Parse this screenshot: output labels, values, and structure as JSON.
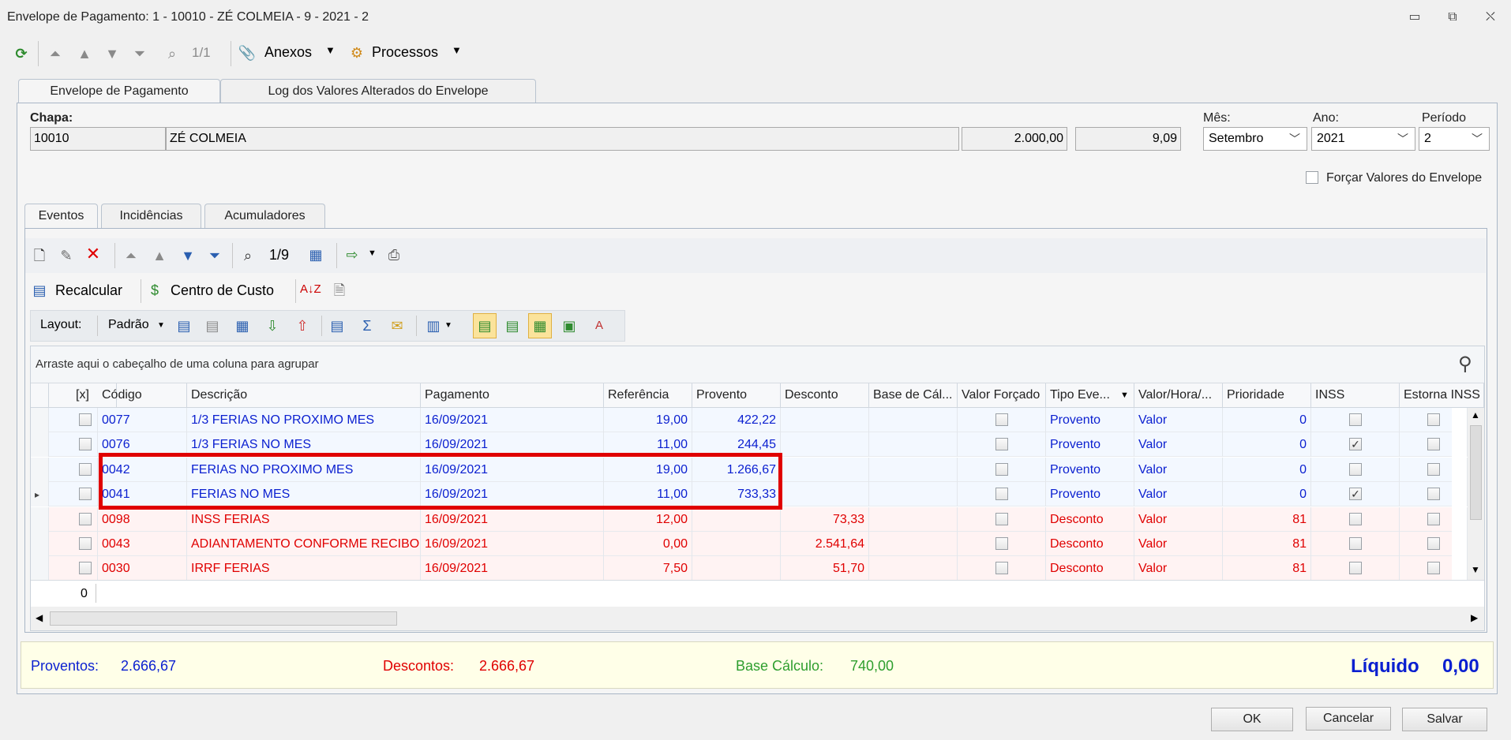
{
  "window": {
    "title": "Envelope de Pagamento: 1 - 10010 - ZÉ COLMEIA - 9 - 2021 - 2",
    "minimize": "▭",
    "restore": "⧉",
    "close": "⛌"
  },
  "toolbar": {
    "counter": "1/1",
    "anexos_label": "Anexos",
    "processos_label": "Processos"
  },
  "main_tabs": [
    "Envelope de Pagamento",
    "Log dos Valores Alterados do Envelope"
  ],
  "header": {
    "chapa_label": "Chapa:",
    "chapa_value": "10010",
    "name_value": "ZÉ COLMEIA",
    "salary_value": "2.000,00",
    "hourly_value": "9,09",
    "mes_label": "Mês:",
    "mes_value": "Setembro",
    "ano_label": "Ano:",
    "ano_value": "2021",
    "periodo_label": "Período",
    "periodo_value": "2",
    "forcar_label": "Forçar Valores do Envelope",
    "forcar_checked": false
  },
  "sub_tabs": [
    "Eventos",
    "Incidências",
    "Acumuladores"
  ],
  "events_toolbar": {
    "counter": "1/9",
    "recalcular_label": "Recalcular",
    "centro_label": "Centro de Custo",
    "layout_label": "Layout:",
    "padrao_label": "Padrão"
  },
  "grid": {
    "group_hint": "Arraste aqui o cabeçalho de uma coluna para agrupar",
    "columns": [
      "[x]",
      "Código",
      "Descrição",
      "Pagamento",
      "Referência",
      "Provento",
      "Desconto",
      "Base de Cál...",
      "Valor Forçado",
      "Tipo Eve...",
      "Valor/Hora/...",
      "Prioridade",
      "INSS",
      "Estorna INSS"
    ],
    "rows": [
      {
        "codigo": "0077",
        "descricao": "1/3 FERIAS NO PROXIMO MES",
        "pagamento": "16/09/2021",
        "referencia": "19,00",
        "provento": "422,22",
        "desconto": "",
        "tipo": "Provento",
        "valor": "Valor",
        "prioridade": "0",
        "inss": false,
        "kind": "provento"
      },
      {
        "codigo": "0076",
        "descricao": "1/3 FERIAS NO MES",
        "pagamento": "16/09/2021",
        "referencia": "11,00",
        "provento": "244,45",
        "desconto": "",
        "tipo": "Provento",
        "valor": "Valor",
        "prioridade": "0",
        "inss": true,
        "kind": "provento"
      },
      {
        "codigo": "0042",
        "descricao": "FERIAS NO PROXIMO MES",
        "pagamento": "16/09/2021",
        "referencia": "19,00",
        "provento": "1.266,67",
        "desconto": "",
        "tipo": "Provento",
        "valor": "Valor",
        "prioridade": "0",
        "inss": false,
        "kind": "provento"
      },
      {
        "codigo": "0041",
        "descricao": "FERIAS NO MES",
        "pagamento": "16/09/2021",
        "referencia": "11,00",
        "provento": "733,33",
        "desconto": "",
        "tipo": "Provento",
        "valor": "Valor",
        "prioridade": "0",
        "inss": true,
        "kind": "provento"
      },
      {
        "codigo": "0098",
        "descricao": "INSS FERIAS",
        "pagamento": "16/09/2021",
        "referencia": "12,00",
        "provento": "",
        "desconto": "73,33",
        "tipo": "Desconto",
        "valor": "Valor",
        "prioridade": "81",
        "inss": false,
        "kind": "desconto"
      },
      {
        "codigo": "0043",
        "descricao": "ADIANTAMENTO CONFORME RECIBO",
        "pagamento": "16/09/2021",
        "referencia": "0,00",
        "provento": "",
        "desconto": "2.541,64",
        "tipo": "Desconto",
        "valor": "Valor",
        "prioridade": "81",
        "inss": false,
        "kind": "desconto"
      },
      {
        "codigo": "0030",
        "descricao": "IRRF FERIAS",
        "pagamento": "16/09/2021",
        "referencia": "7,50",
        "provento": "",
        "desconto": "51,70",
        "tipo": "Desconto",
        "valor": "Valor",
        "prioridade": "81",
        "inss": false,
        "kind": "desconto"
      }
    ],
    "footer_count": "0"
  },
  "totals": {
    "proventos_label": "Proventos:",
    "proventos_value": "2.666,67",
    "descontos_label": "Descontos:",
    "descontos_value": "2.666,67",
    "base_label": "Base Cálculo:",
    "base_value": "740,00",
    "liquido_label": "Líquido",
    "liquido_colon": ":",
    "liquido_value": "0,00"
  },
  "buttons": {
    "ok": "OK",
    "cancelar": "Cancelar",
    "salvar": "Salvar"
  },
  "colors": {
    "provento_text": "#0a1fd0",
    "desconto_text": "#e00000",
    "highlight_border": "#e00000",
    "totals_bg": "#ffffe8"
  }
}
